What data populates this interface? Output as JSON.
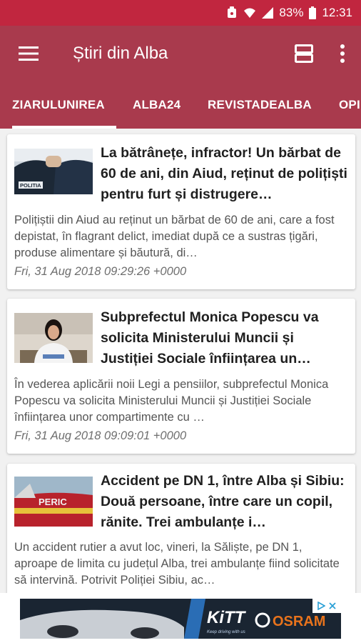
{
  "status_bar": {
    "battery": "83%",
    "time": "12:31"
  },
  "app_bar": {
    "title": "Știri din Alba"
  },
  "tabs": [
    {
      "label": "ZIARULUNIREA",
      "active": true
    },
    {
      "label": "ALBA24",
      "active": false
    },
    {
      "label": "REVISTADEALBA",
      "active": false
    },
    {
      "label": "OPI",
      "active": false
    }
  ],
  "articles": [
    {
      "title": "La bătrânețe, infractor! Un bărbat de 60 de ani, din Aiud, reținut de polițiști pentru furt și distrugere…",
      "description": "Polițiștii din Aiud au reținut un bărbat de 60 de ani, care a fost depistat, în flagrant delict, imediat după ce a sustras țigări, produse alimentare și băutură, di…",
      "date": "Fri, 31 Aug 2018 09:29:26 +0000",
      "thumb_text": "POLITIA"
    },
    {
      "title": "Subprefectul Monica Popescu va solicita Ministerului Muncii și Justiției Sociale înființarea un…",
      "description": "În vederea aplicării noii Legi a pensiilor, subprefectul Monica Popescu va solicita Ministerului Muncii și Justiției Sociale înființarea unor compartimente cu …",
      "date": "Fri, 31 Aug 2018 09:09:01 +0000"
    },
    {
      "title": "Accident pe DN 1, între Alba și Sibiu: Două persoane, între care un copil, rănite. Trei ambulanțe i…",
      "description": "Un accident rutier a avut loc, vineri, la Săliște, pe DN 1, aproape de limita cu județul Alba, trei ambulanțe fiind solicitate să intervină. Potrivit Poliției Sibiu, ac…",
      "date": "",
      "thumb_text": "PERIC"
    }
  ],
  "ad": {
    "brand1": "KiTT",
    "brand1_tagline": "Keep driving with us",
    "brand2": "OSRAM"
  },
  "colors": {
    "status_bar": "#c1263f",
    "app_bar": "#a93a4d",
    "background": "#f1f1f1"
  }
}
